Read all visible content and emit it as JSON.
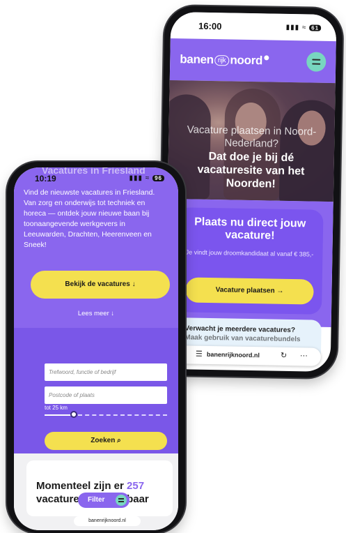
{
  "back_phone": {
    "status": {
      "time": "16:00",
      "signal": "all",
      "battery": "61"
    },
    "nav": {
      "logo": {
        "part1": "banen",
        "part2": "rijk",
        "part3": "noord"
      }
    },
    "hero": {
      "line_faded": "Vacature plaatsen in Noord-Nederland?",
      "line_bold": "Dat doe je bij dé vacaturesite van het Noorden!"
    },
    "cta": {
      "title": "Plaats nu direct jouw vacature!",
      "desc": "Je vindt jouw droomkandidaat al vanaf € 385,-",
      "button": "Vacature plaatsen →"
    },
    "info": {
      "question": "Verwacht je meerdere vacatures?",
      "sub": "Maak gebruik van vacaturebundels"
    },
    "browser": {
      "url": "banenrijknoord.nl"
    }
  },
  "front_phone": {
    "status": {
      "time": "10:19",
      "battery": "96"
    },
    "heading_peek": "Vacatures in Friesland",
    "intro": "Vind de nieuwste vacatures in Friesland. Van zorg en onderwijs tot techniek en horeca — ontdek jouw nieuwe baan bij toonaangevende werkgevers in Leeuwarden, Drachten, Heerenveen en Sneek!",
    "bekijk_button": "Bekijk de vacatures ↓",
    "lees_meer": "Lees meer ↓",
    "search": {
      "keyword_placeholder": "Trefwoord, functie of bedrijf",
      "postcode_placeholder": "Postcode of plaats",
      "distance_label": "tot 25 km",
      "distance_level": 0.24,
      "search_button": "Zoeken ⌕"
    },
    "results": {
      "prefix": "Momenteel zijn er",
      "count": "257",
      "line2": "vacatures beschikbaar"
    },
    "filter_button": "Filter",
    "browser": {
      "url": "banenrijknoord.nl"
    }
  },
  "colors": {
    "purple": "#8a66ee",
    "yellow": "#f4e04f",
    "mint": "#78d6c0"
  }
}
